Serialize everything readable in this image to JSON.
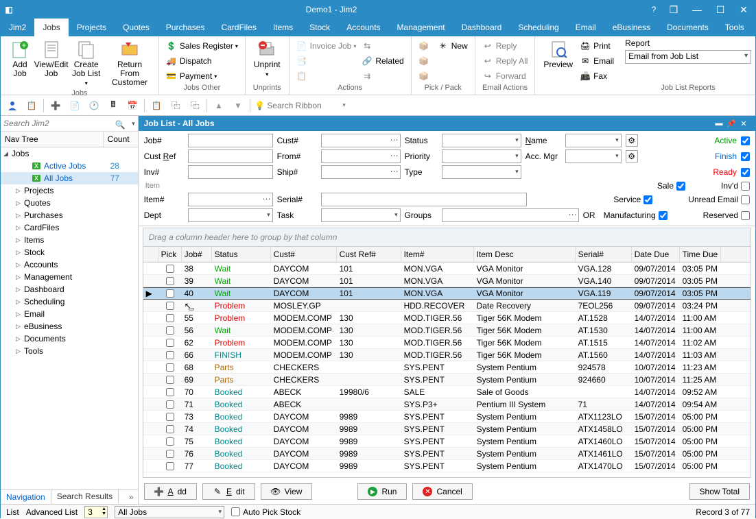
{
  "window": {
    "title": "Demo1 - Jim2"
  },
  "maintabs": [
    "Jim2",
    "Jobs",
    "Projects",
    "Quotes",
    "Purchases",
    "CardFiles",
    "Items",
    "Stock",
    "Accounts",
    "Management",
    "Dashboard",
    "Scheduling",
    "Email",
    "eBusiness",
    "Documents",
    "Tools"
  ],
  "maintab_active": 1,
  "ribbon": {
    "jobs": {
      "add": "Add\nJob",
      "view": "View/Edit\nJob",
      "create": "Create\nJob List",
      "return": "Return From\nCustomer",
      "group": "Jobs"
    },
    "other": {
      "sales": "Sales Register",
      "dispatch": "Dispatch",
      "payment": "Payment",
      "group": "Jobs Other"
    },
    "unprint": {
      "label": "Unprint",
      "group": "Unprints"
    },
    "actions": {
      "invoice": "Invoice Job",
      "related": "Related",
      "group": "Actions"
    },
    "pick": {
      "new": "New",
      "group": "Pick / Pack"
    },
    "email": {
      "reply": "Reply",
      "replyall": "Reply All",
      "forward": "Forward",
      "group": "Email Actions"
    },
    "preview": {
      "label": "Preview"
    },
    "print": {
      "print": "Print",
      "email": "Email",
      "fax": "Fax"
    },
    "reports": {
      "label": "Report",
      "value": "Email from Job List",
      "group": "Job List Reports"
    }
  },
  "qat": {
    "search": "Search Ribbon"
  },
  "leftsearch": "Search Jim2",
  "navhead": {
    "c1": "Nav Tree",
    "c2": "Count"
  },
  "nav": {
    "root": "Jobs",
    "children": [
      {
        "label": "Active Jobs",
        "count": "28"
      },
      {
        "label": "All Jobs",
        "count": "77",
        "sel": true
      }
    ],
    "rest": [
      "Projects",
      "Quotes",
      "Purchases",
      "CardFiles",
      "Items",
      "Stock",
      "Accounts",
      "Management",
      "Dashboard",
      "Scheduling",
      "Email",
      "eBusiness",
      "Documents",
      "Tools"
    ]
  },
  "lefttabs": {
    "nav": "Navigation",
    "sr": "Search Results"
  },
  "listtitle": "Job List - All Jobs",
  "filter": {
    "job": "Job#",
    "cust": "Cust#",
    "status": "Status",
    "name": "Name",
    "custref": "Cust Ref",
    "from": "From#",
    "priority": "Priority",
    "accmgr": "Acc. Mgr",
    "inv": "Inv#",
    "ship": "Ship#",
    "type": "Type",
    "item_sect": "Item",
    "item": "Item#",
    "serial": "Serial#",
    "dept": "Dept",
    "task": "Task",
    "groups": "Groups",
    "or": "OR",
    "active": "Active",
    "finish": "Finish",
    "ready": "Ready",
    "sale": "Sale",
    "service": "Service",
    "manuf": "Manufacturing",
    "invd": "Inv'd",
    "unread": "Unread Email",
    "reserved": "Reserved"
  },
  "groupbar": "Drag a column header here to group by that column",
  "cols": [
    "",
    "Pick",
    "Job#",
    "Status",
    "Cust#",
    "Cust Ref#",
    "Item#",
    "Item Desc",
    "Serial#",
    "Date Due",
    "Time Due"
  ],
  "rows": [
    {
      "job": "38",
      "status": "Wait",
      "scls": "wait",
      "cust": "DAYCOM",
      "cref": "101",
      "item": "MON.VGA",
      "desc": "VGA Monitor",
      "ser": "VGA.128",
      "due": "09/07/2014",
      "time": "03:05 PM"
    },
    {
      "job": "39",
      "status": "Wait",
      "scls": "wait",
      "cust": "DAYCOM",
      "cref": "101",
      "item": "MON.VGA",
      "desc": "VGA Monitor",
      "ser": "VGA.140",
      "due": "09/07/2014",
      "time": "03:05 PM"
    },
    {
      "job": "40",
      "status": "Wait",
      "scls": "wait",
      "cust": "DAYCOM",
      "cref": "101",
      "item": "MON.VGA",
      "desc": "VGA Monitor",
      "ser": "VGA.119",
      "due": "09/07/2014",
      "time": "03:05 PM",
      "sel": true
    },
    {
      "job": "",
      "status": "Problem",
      "scls": "prob",
      "cust": "MOSLEY.GP",
      "cref": "",
      "item": "HDD.RECOVER",
      "desc": "Date Recovery",
      "ser": "7EOL256",
      "due": "09/07/2014",
      "time": "03:24 PM",
      "cursor": true
    },
    {
      "job": "55",
      "status": "Problem",
      "scls": "prob",
      "cust": "MODEM.COMP",
      "cref": "130",
      "item": "MOD.TIGER.56",
      "desc": "Tiger 56K Modem",
      "ser": "AT.1528",
      "due": "14/07/2014",
      "time": "11:00 AM"
    },
    {
      "job": "56",
      "status": "Wait",
      "scls": "wait",
      "cust": "MODEM.COMP",
      "cref": "130",
      "item": "MOD.TIGER.56",
      "desc": "Tiger 56K Modem",
      "ser": "AT.1530",
      "due": "14/07/2014",
      "time": "11:00 AM"
    },
    {
      "job": "62",
      "status": "Problem",
      "scls": "prob",
      "cust": "MODEM.COMP",
      "cref": "130",
      "item": "MOD.TIGER.56",
      "desc": "Tiger 56K Modem",
      "ser": "AT.1515",
      "due": "14/07/2014",
      "time": "11:02 AM"
    },
    {
      "job": "66",
      "status": "FINISH",
      "scls": "fin",
      "cust": "MODEM.COMP",
      "cref": "130",
      "item": "MOD.TIGER.56",
      "desc": "Tiger 56K Modem",
      "ser": "AT.1560",
      "due": "14/07/2014",
      "time": "11:03 AM"
    },
    {
      "job": "68",
      "status": "Parts",
      "scls": "part",
      "cust": "CHECKERS",
      "cref": "",
      "item": "SYS.PENT",
      "desc": "System Pentium",
      "ser": "924578",
      "due": "10/07/2014",
      "time": "11:23 AM"
    },
    {
      "job": "69",
      "status": "Parts",
      "scls": "part",
      "cust": "CHECKERS",
      "cref": "",
      "item": "SYS.PENT",
      "desc": "System Pentium",
      "ser": "924660",
      "due": "10/07/2014",
      "time": "11:25 AM"
    },
    {
      "job": "70",
      "status": "Booked",
      "scls": "book",
      "cust": "ABECK",
      "cref": "19980/6",
      "item": "SALE",
      "desc": "Sale of Goods",
      "ser": "",
      "due": "14/07/2014",
      "time": "09:52 AM"
    },
    {
      "job": "71",
      "status": "Booked",
      "scls": "book",
      "cust": "ABECK",
      "cref": "",
      "item": "SYS.P3+",
      "desc": "Pentium III System",
      "ser": "71",
      "due": "14/07/2014",
      "time": "09:54 AM"
    },
    {
      "job": "73",
      "status": "Booked",
      "scls": "book",
      "cust": "DAYCOM",
      "cref": "9989",
      "item": "SYS.PENT",
      "desc": "System Pentium",
      "ser": "ATX1123LO",
      "due": "15/07/2014",
      "time": "05:00 PM"
    },
    {
      "job": "74",
      "status": "Booked",
      "scls": "book",
      "cust": "DAYCOM",
      "cref": "9989",
      "item": "SYS.PENT",
      "desc": "System Pentium",
      "ser": "ATX1458LO",
      "due": "15/07/2014",
      "time": "05:00 PM"
    },
    {
      "job": "75",
      "status": "Booked",
      "scls": "book",
      "cust": "DAYCOM",
      "cref": "9989",
      "item": "SYS.PENT",
      "desc": "System Pentium",
      "ser": "ATX1460LO",
      "due": "15/07/2014",
      "time": "05:00 PM"
    },
    {
      "job": "76",
      "status": "Booked",
      "scls": "book",
      "cust": "DAYCOM",
      "cref": "9989",
      "item": "SYS.PENT",
      "desc": "System Pentium",
      "ser": "ATX1461LO",
      "due": "15/07/2014",
      "time": "05:00 PM"
    },
    {
      "job": "77",
      "status": "Booked",
      "scls": "book",
      "cust": "DAYCOM",
      "cref": "9989",
      "item": "SYS.PENT",
      "desc": "System Pentium",
      "ser": "ATX1470LO",
      "due": "15/07/2014",
      "time": "05:00 PM"
    }
  ],
  "actions": {
    "add": "Add",
    "edit": "Edit",
    "view": "View",
    "run": "Run",
    "cancel": "Cancel",
    "total": "Show Total"
  },
  "status": {
    "list": "List",
    "adv": "Advanced List",
    "num": "3",
    "name": "All Jobs",
    "auto": "Auto Pick Stock",
    "rec": "Record 3 of 77"
  }
}
